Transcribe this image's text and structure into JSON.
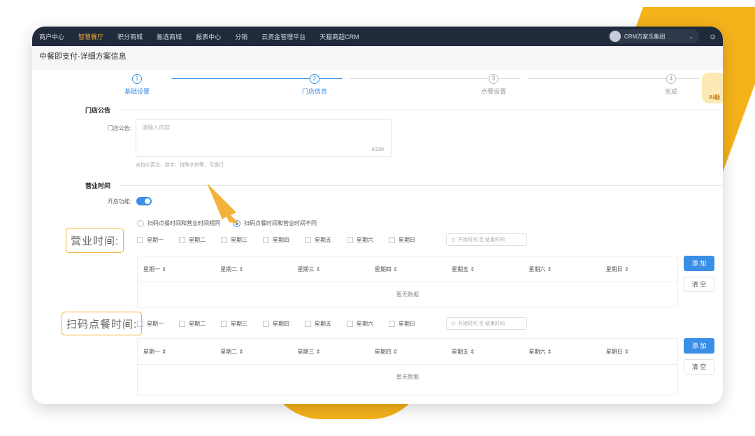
{
  "nav": {
    "items": [
      "商户中心",
      "智慧餐厅",
      "积分商城",
      "氪选商城",
      "报表中心",
      "分销",
      "云资金管理平台",
      "天猫商超CRM"
    ],
    "active_index": 1,
    "org_name": "CRM万家乐集团"
  },
  "page": {
    "title": "中餐即支付-详细方案信息"
  },
  "steps": [
    {
      "num": "1",
      "label": "基础设置",
      "state": "done"
    },
    {
      "num": "2",
      "label": "门店信息",
      "state": "active"
    },
    {
      "num": "3",
      "label": "点餐设置",
      "state": "todo"
    },
    {
      "num": "4",
      "label": "完成",
      "state": "todo"
    }
  ],
  "ai_badge": "AI助",
  "notice": {
    "section_title": "门店公告",
    "field_label": "门店公告:",
    "placeholder": "请输入内容",
    "counter": "0/200",
    "hint": "支持中英文、数字、特殊字符等，可换行"
  },
  "hours": {
    "section_title": "营业时间",
    "switch_label": "开启功能:",
    "radio_same": "扫码点餐时间和营业时间相同",
    "radio_diff": "扫码点餐时间和营业时间不同",
    "business_label": "营业时间:",
    "order_label": "扫码点餐时间:",
    "days_row1": [
      "星期一",
      "星期二",
      "星期三",
      "星期四",
      "星期五",
      "星期六",
      "星期日"
    ],
    "days_row2": [
      "星期一",
      "星期二",
      "星期三",
      "星期四",
      "星期五",
      "星期六",
      "星期日"
    ],
    "time_placeholder": "开始时间 至 结束时间",
    "table_headers": [
      "星期一 ⇕",
      "星期二 ⇕",
      "星期三 ⇕",
      "星期四 ⇕",
      "星期五 ⇕",
      "星期六 ⇕",
      "星期日 ⇕"
    ],
    "empty_text": "暂无数据",
    "add_label": "添 加",
    "clear_label": "清 空"
  },
  "colors": {
    "accent": "#3a8ee6",
    "callout": "#f3b23a",
    "nav_bg": "#1f2a3a"
  }
}
